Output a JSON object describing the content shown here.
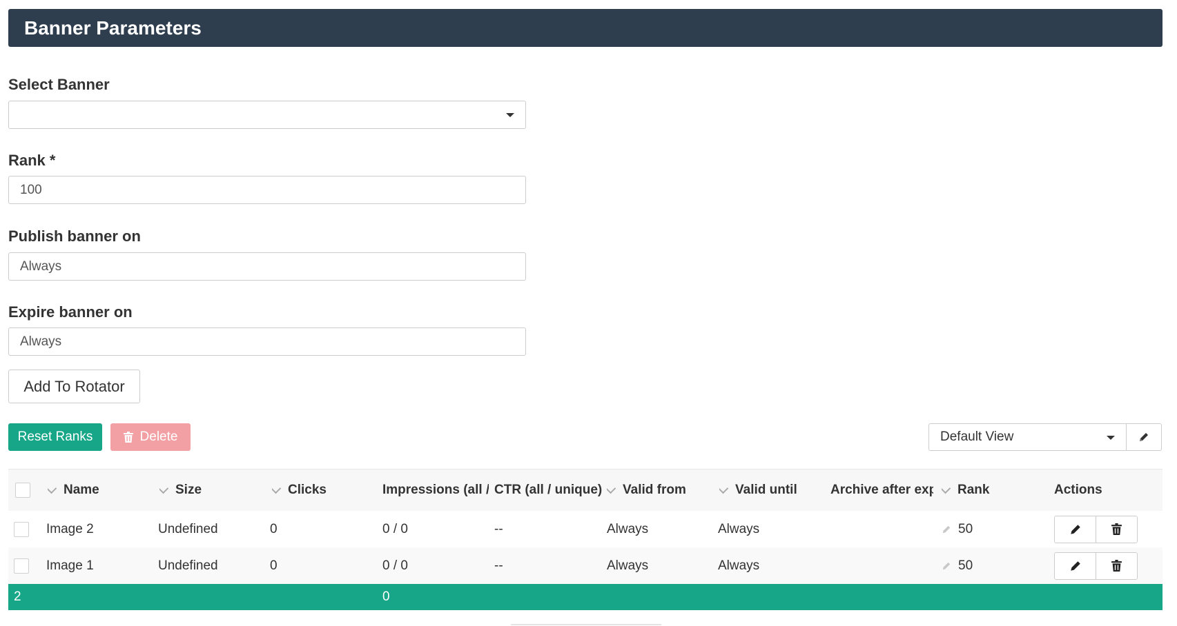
{
  "panel": {
    "title": "Banner Parameters"
  },
  "form": {
    "select_banner": {
      "label": "Select Banner",
      "value": ""
    },
    "rank": {
      "label": "Rank *",
      "value": "100"
    },
    "publish": {
      "label": "Publish banner on",
      "value": "Always"
    },
    "expire": {
      "label": "Expire banner on",
      "value": "Always"
    },
    "add_button": "Add To Rotator"
  },
  "toolbar": {
    "reset_label": "Reset Ranks",
    "delete_label": "Delete",
    "view_value": "Default View"
  },
  "grid": {
    "columns": [
      "Name",
      "Size",
      "Clicks",
      "Impressions (all / unique)",
      "CTR (all / unique)",
      "Valid from",
      "Valid until",
      "Archive after expiration",
      "Rank",
      "Actions"
    ],
    "rows": [
      {
        "name": "Image 2",
        "size": "Undefined",
        "clicks": "0",
        "impressions": "0 / 0",
        "ctr": "--",
        "valid_from": "Always",
        "valid_until": "Always",
        "archive": "",
        "rank": "50"
      },
      {
        "name": "Image 1",
        "size": "Undefined",
        "clicks": "0",
        "impressions": "0 / 0",
        "ctr": "--",
        "valid_from": "Always",
        "valid_until": "Always",
        "archive": "",
        "rank": "50"
      }
    ],
    "summary": {
      "count": "2",
      "impressions": "0"
    }
  },
  "icons": {
    "delete": "trash-icon",
    "edit": "pencil-icon",
    "caret": "caret-down-icon",
    "sort": "chevron-down-icon"
  },
  "colors": {
    "header_bg": "#2f3e4e",
    "accent": "#18a689",
    "delete_bg": "#f3a0a4"
  }
}
